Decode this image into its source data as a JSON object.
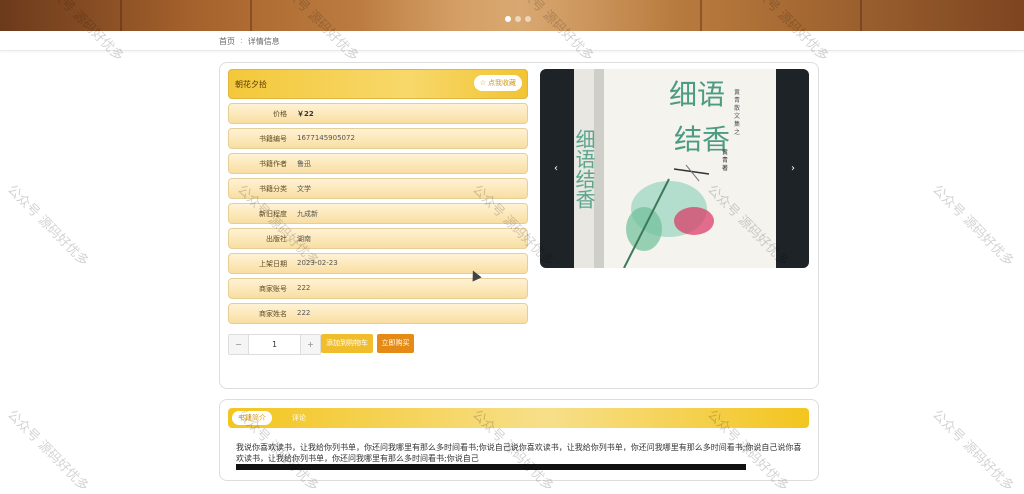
{
  "banner": {
    "slides": 3,
    "active_slide": 1
  },
  "breadcrumb": {
    "home": "首页",
    "separator": ":",
    "current": "详情信息"
  },
  "product": {
    "title": "朝花夕拾",
    "favorite_label": "点我收藏",
    "fields": [
      {
        "label": "价格",
        "value": "￥22"
      },
      {
        "label": "书籍编号",
        "value": "1677145905072"
      },
      {
        "label": "书籍作者",
        "value": "鲁迅"
      },
      {
        "label": "书籍分类",
        "value": "文学"
      },
      {
        "label": "新旧程度",
        "value": "九成新"
      },
      {
        "label": "出版社",
        "value": "湖南"
      },
      {
        "label": "上架日期",
        "value": "2023-02-23"
      },
      {
        "label": "商家账号",
        "value": "222"
      },
      {
        "label": "商家姓名",
        "value": "222"
      }
    ],
    "quantity": "1",
    "add_cart_label": "添加到购物车",
    "buy_label": "立即购买"
  },
  "gallery": {
    "prev": "‹",
    "next": "›",
    "cover_title": "细语结香",
    "cover_series": "黄 青 散 文 集 之",
    "cover_author": "黄 青 著"
  },
  "detail_tabs": {
    "tabs": [
      "书籍简介",
      "评论"
    ],
    "active_tab": "书籍简介",
    "intro_text": "我说你喜欢读书，让我给你列书单，你还问我哪里有那么多时间看书;你说自己说你喜欢读书，让我给你列书单，你还问我哪里有那么多时间看书;你说自己说你喜欢读书，让我给你列书单，你还问我哪里有那么多时间看书;你说自己"
  },
  "watermark": "公众号 源码好优多",
  "colors": {
    "accent": "#f3c51f",
    "buy": "#e58a14",
    "field_bg": "#f8dea2"
  }
}
